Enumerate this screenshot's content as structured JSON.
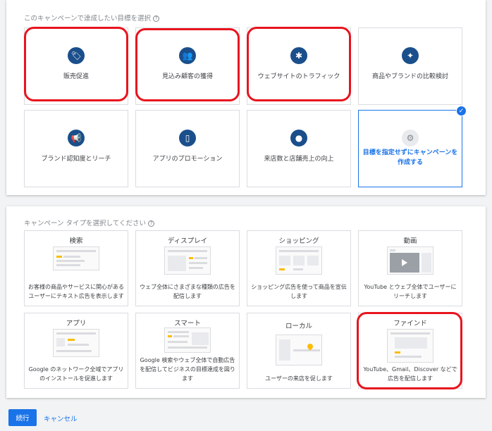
{
  "goals_section": {
    "title": "このキャンペーンで達成したい目標を選択",
    "help": "?",
    "goals": [
      {
        "label": "販売促進",
        "icon": "tag-icon",
        "glyph": "🏷"
      },
      {
        "label": "見込み顧客の獲得",
        "icon": "people-icon",
        "glyph": "👥"
      },
      {
        "label": "ウェブサイトのトラフィック",
        "icon": "cursor-click-icon",
        "glyph": "✱"
      },
      {
        "label": "商品やブランドの比較検討",
        "icon": "sparkle-icon",
        "glyph": "✦"
      },
      {
        "label": "ブランド認知度とリーチ",
        "icon": "megaphone-icon",
        "glyph": "📢"
      },
      {
        "label": "アプリのプロモーション",
        "icon": "phone-icon",
        "glyph": "▯"
      },
      {
        "label": "来店数と店舗売上の向上",
        "icon": "location-pin-icon",
        "glyph": "●"
      },
      {
        "label": "目標を指定せずにキャンペーンを作成する",
        "icon": "gear-icon",
        "glyph": "⚙",
        "selected": true
      }
    ],
    "check": "✓"
  },
  "types_section": {
    "title": "キャンペーン タイプを選択してください",
    "help": "?",
    "types": [
      {
        "name": "検索",
        "description": "お客様の商品やサービスに関心があるユーザーにテキスト広告を表示します"
      },
      {
        "name": "ディスプレイ",
        "description": "ウェブ全体にさまざまな種類の広告を配信します"
      },
      {
        "name": "ショッピング",
        "description": "ショッピング広告を使って商品を宣伝します"
      },
      {
        "name": "動画",
        "description": "YouTube とウェブ全体でユーザーにリーチします"
      },
      {
        "name": "アプリ",
        "description": "Google のネットワーク全域でアプリのインストールを促進します"
      },
      {
        "name": "スマート",
        "description": "Google 検索やウェブ全体で自動広告を配信してビジネスの目標達成を図ります"
      },
      {
        "name": "ローカル",
        "description": "ユーザーの来店を促します"
      },
      {
        "name": "ファインド",
        "description": "YouTube、Gmail、Discover などで広告を配信します"
      }
    ]
  },
  "actions": {
    "continue": "続行",
    "cancel": "キャンセル"
  },
  "colors": {
    "accent": "#1a73e8",
    "goal_icon_bg": "#1a4f8b",
    "annotation": "#e8141e"
  }
}
